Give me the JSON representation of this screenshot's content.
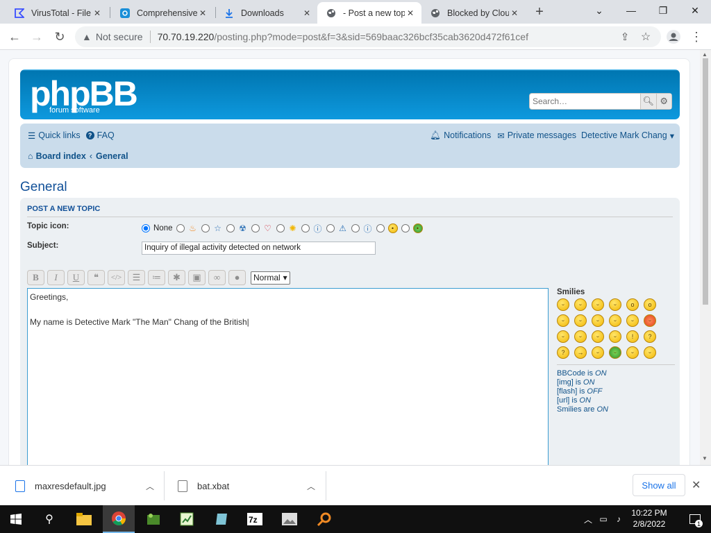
{
  "browser": {
    "tabs": [
      {
        "title": "VirusTotal - File",
        "icon": "virustotal-icon"
      },
      {
        "title": "Comprehensive",
        "icon": "shield-icon"
      },
      {
        "title": "Downloads",
        "icon": "download-icon"
      },
      {
        "title": "- Post a new top",
        "icon": "globe-icon",
        "active": true
      },
      {
        "title": "Blocked by Clou",
        "icon": "globe-icon"
      }
    ],
    "not_secure": "Not secure",
    "url_host": "70.70.19.220",
    "url_path": "/posting.php?mode=post&f=3&sid=569baac326bcf35cab3620d472f61cef"
  },
  "forum": {
    "logo": "phpBB",
    "logo_sub": "forum software",
    "search_placeholder": "Search…",
    "nav": {
      "quick_links": "Quick links",
      "faq": "FAQ",
      "notifications": "Notifications",
      "private_messages": "Private messages",
      "user": "Detective Mark Chang",
      "board_index": "Board index",
      "crumb": "General"
    },
    "forum_title": "General",
    "panel_title": "POST A NEW TOPIC",
    "topic_icon_label": "Topic icon:",
    "topic_icon_none": "None",
    "subject_label": "Subject:",
    "subject_value": "Inquiry of illegal activity detected on network",
    "font_size": "Normal",
    "message_line1": "Greetings,",
    "message_line2": "My name is Detective Mark \"The Man\" Chang of the British",
    "smilies_title": "Smilies",
    "bbcode": {
      "prefix": "BBCode is ",
      "state": "ON"
    },
    "img": {
      "prefix": "[img] is ",
      "state": "ON"
    },
    "flash": {
      "prefix": "[flash] is ",
      "state": "OFF"
    },
    "url": {
      "prefix": "[url] is ",
      "state": "ON"
    },
    "smilies_on": {
      "prefix": "Smilies are ",
      "state": "ON"
    }
  },
  "downloads": {
    "files": [
      "maxresdefault.jpg",
      "bat.xbat"
    ],
    "show_all": "Show all"
  },
  "taskbar": {
    "time": "10:22 PM",
    "date": "2/8/2022",
    "notification_count": "1"
  }
}
